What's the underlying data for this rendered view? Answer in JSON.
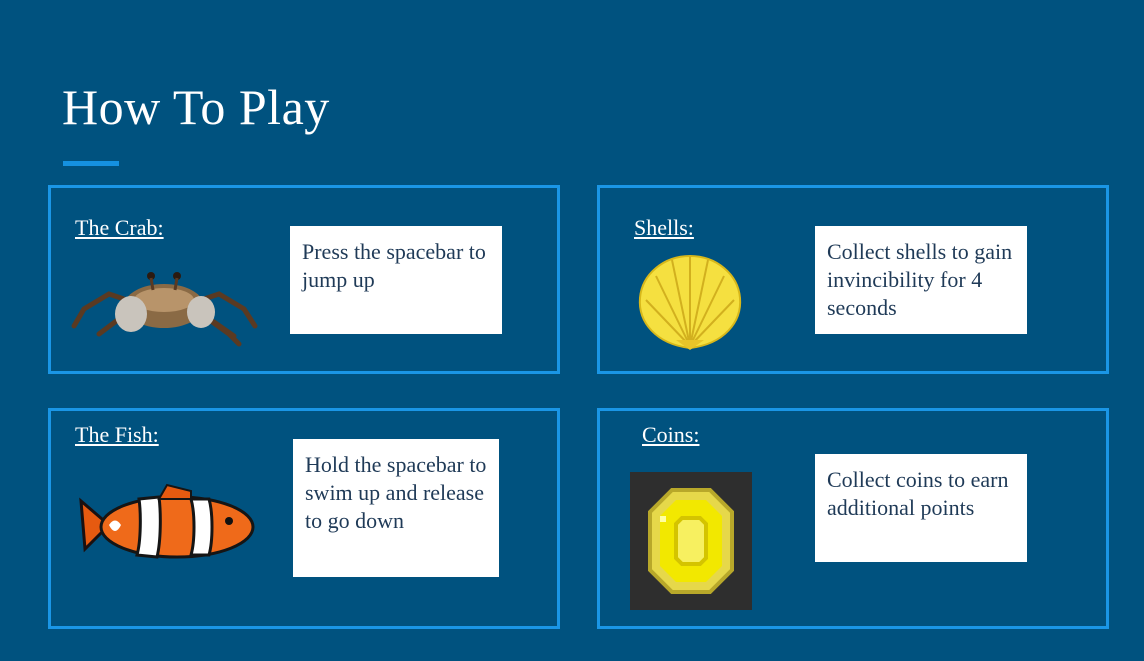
{
  "page": {
    "title": "How To Play"
  },
  "cards": [
    {
      "label": "The Crab:",
      "description": "Press the spacebar to jump up",
      "icon": "crab-icon"
    },
    {
      "label": "Shells:",
      "description": "Collect shells to gain invincibility for 4 seconds",
      "icon": "shell-icon"
    },
    {
      "label": "The Fish:",
      "description": "Hold the spacebar to swim up and release to go down",
      "icon": "clownfish-icon"
    },
    {
      "label": "Coins:",
      "description": "Collect coins to earn additional points",
      "icon": "coin-icon"
    }
  ],
  "colors": {
    "background": "#00527f",
    "accent": "#1a96e6",
    "text_box": "#ffffff"
  }
}
